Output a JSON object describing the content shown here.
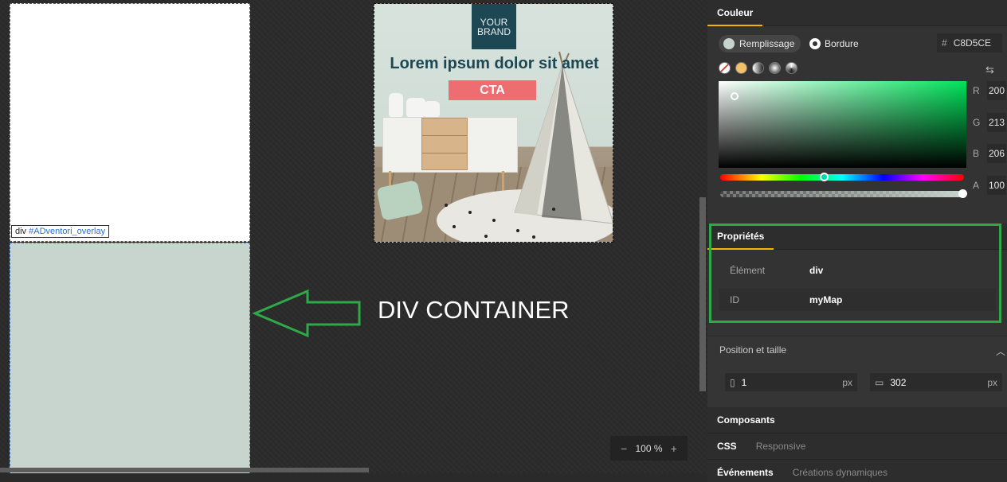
{
  "canvas": {
    "overlay_label": {
      "tag": "div",
      "selector": "#ADventori_overlay"
    },
    "ad": {
      "brand_line1": "YOUR",
      "brand_line2": "BRAND",
      "headline": "Lorem ipsum dolor sit amet",
      "cta": "CTA"
    },
    "annotation": {
      "text": "DIV CONTAINER"
    },
    "zoom": {
      "minus": "−",
      "value": "100 %",
      "plus": "+"
    }
  },
  "panel": {
    "color": {
      "tab_label": "Couleur",
      "fill_label": "Remplissage",
      "border_label": "Bordure",
      "hex_hash": "#",
      "hex_value": "C8D5CE",
      "r_label": "R",
      "r_value": "200",
      "g_label": "G",
      "g_value": "213",
      "b_label": "B",
      "b_value": "206",
      "a_label": "A",
      "a_value": "100",
      "fill_color": "#c8d5ce"
    },
    "properties": {
      "tab_label": "Propriétés",
      "element_key": "Élément",
      "element_value": "div",
      "id_key": "ID",
      "id_value": "myMap"
    },
    "position": {
      "title": "Position et taille",
      "x_value": "1",
      "x_unit": "px",
      "y_value": "302",
      "y_unit": "px"
    },
    "bottom_tabs": {
      "components": "Composants",
      "css": "CSS",
      "responsive": "Responsive",
      "events": "Événements",
      "dynamic": "Créations dynamiques"
    }
  },
  "colors": {
    "accent": "#f4b400",
    "highlight_frame": "#2fa84a",
    "container_fill": "#c8d5ce"
  }
}
